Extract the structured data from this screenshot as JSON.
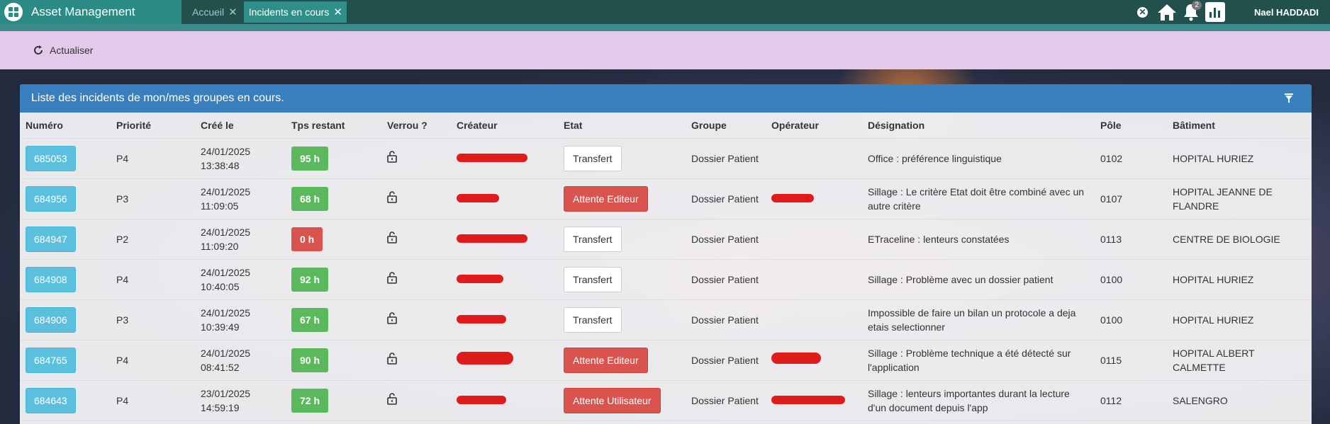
{
  "app": {
    "title": "Asset Management"
  },
  "tabs": [
    {
      "label": "Accueil",
      "active": false
    },
    {
      "label": "Incidents en cours",
      "active": true
    }
  ],
  "header": {
    "notifications_count": "2",
    "username": "Nael HADDADI"
  },
  "toolbar": {
    "refresh_label": "Actualiser"
  },
  "panel": {
    "title": "Liste des incidents de mon/mes groupes en cours.",
    "columns": [
      "Numéro",
      "Priorité",
      "Créé le",
      "Tps restant",
      "Verrou ?",
      "Créateur",
      "Etat",
      "Groupe",
      "Opérateur",
      "Désignation",
      "Pôle",
      "Bâtiment"
    ]
  },
  "rows": [
    {
      "numero": "685053",
      "priorite": "P4",
      "date": "24/01/2025",
      "heure": "13:38:48",
      "tps": "95 h",
      "tps_color": "green",
      "etat": "Transfert",
      "etat_style": "white",
      "groupe": "Dossier Patient",
      "designation_1": "Office : préférence linguistique",
      "designation_2": "",
      "pole": "0102",
      "batiment_1": "HOPITAL HURIEZ",
      "batiment_2": ""
    },
    {
      "numero": "684956",
      "priorite": "P3",
      "date": "24/01/2025",
      "heure": "11:09:05",
      "tps": "68 h",
      "tps_color": "green",
      "etat": "Attente Editeur",
      "etat_style": "red",
      "groupe": "Dossier Patient",
      "designation_1": "Sillage : Le critère Etat doit être combiné avec un",
      "designation_2": "autre critère",
      "pole": "0107",
      "batiment_1": "HOPITAL JEANNE DE",
      "batiment_2": "FLANDRE"
    },
    {
      "numero": "684947",
      "priorite": "P2",
      "date": "24/01/2025",
      "heure": "11:09:20",
      "tps": "0 h",
      "tps_color": "red",
      "etat": "Transfert",
      "etat_style": "white",
      "groupe": "Dossier Patient",
      "designation_1": "ETraceline : lenteurs constatées",
      "designation_2": "",
      "pole": "0113",
      "batiment_1": "CENTRE DE BIOLOGIE",
      "batiment_2": ""
    },
    {
      "numero": "684908",
      "priorite": "P4",
      "date": "24/01/2025",
      "heure": "10:40:05",
      "tps": "92 h",
      "tps_color": "green",
      "etat": "Transfert",
      "etat_style": "white",
      "groupe": "Dossier Patient",
      "designation_1": "Sillage : Problème avec un dossier patient",
      "designation_2": "",
      "pole": "0100",
      "batiment_1": "HOPITAL HURIEZ",
      "batiment_2": ""
    },
    {
      "numero": "684906",
      "priorite": "P3",
      "date": "24/01/2025",
      "heure": "10:39:49",
      "tps": "67 h",
      "tps_color": "green",
      "etat": "Transfert",
      "etat_style": "white",
      "groupe": "Dossier Patient",
      "designation_1": "Impossible de faire un bilan un protocole a deja",
      "designation_2": "etais selectionner",
      "pole": "0100",
      "batiment_1": "HOPITAL HURIEZ",
      "batiment_2": ""
    },
    {
      "numero": "684765",
      "priorite": "P4",
      "date": "24/01/2025",
      "heure": "08:41:52",
      "tps": "90 h",
      "tps_color": "green",
      "etat": "Attente Editeur",
      "etat_style": "red",
      "groupe": "Dossier Patient",
      "designation_1": "Sillage : Problème technique a été détecté sur",
      "designation_2": "l'application",
      "pole": "0115",
      "batiment_1": "HOPITAL ALBERT",
      "batiment_2": "CALMETTE"
    },
    {
      "numero": "684643",
      "priorite": "P4",
      "date": "23/01/2025",
      "heure": "14:59:19",
      "tps": "72 h",
      "tps_color": "green",
      "etat": "Attente Utilisateur",
      "etat_style": "red",
      "groupe": "Dossier Patient",
      "designation_1": "Sillage : lenteurs importantes durant la lecture",
      "designation_2": "d'un document depuis l'app",
      "pole": "0112",
      "batiment_1": "SALENGRO",
      "batiment_2": ""
    }
  ],
  "colors": {
    "topbar": "#21504d",
    "brand": "#2b8a84",
    "toolbar": "#e3c9ea",
    "panel_head": "#3a7fbd",
    "info": "#5bc0de",
    "success": "#5cb85c",
    "danger": "#d9534f",
    "redaction": "#e01b1b"
  },
  "icons": {
    "logo": "grid-logo-icon",
    "home": "home-icon",
    "bell": "bell-icon",
    "stats": "bar-chart-icon",
    "refresh": "refresh-icon",
    "filter": "filter-icon",
    "lock": "unlock-icon"
  }
}
